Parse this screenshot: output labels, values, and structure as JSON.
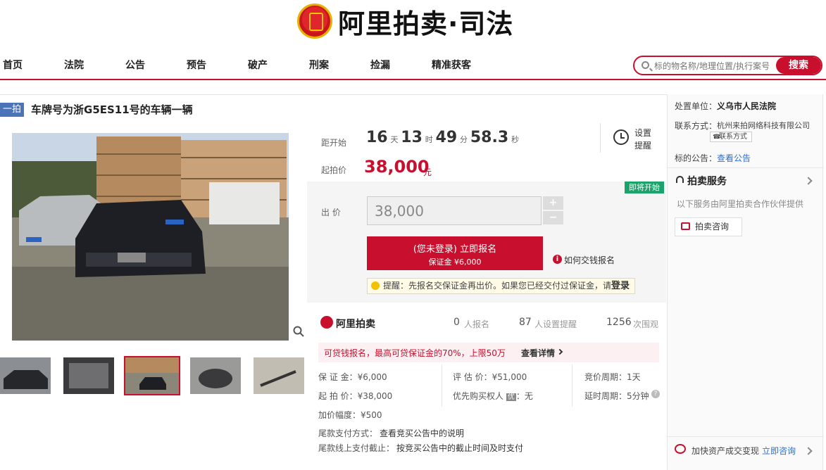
{
  "header": {
    "logo_text": "阿里拍卖·司法"
  },
  "nav": {
    "items": [
      "首页",
      "法院",
      "公告",
      "预告",
      "破产",
      "刑案",
      "捡漏",
      "精准获客"
    ]
  },
  "search": {
    "placeholder": "标的物名称/地理位置/执行案号",
    "button_label": "搜索"
  },
  "item": {
    "tag": "一拍",
    "title": "车牌号为浙G5ES11号的车辆一辆"
  },
  "timer": {
    "start_label": "距开始",
    "days": "16",
    "days_unit": "天",
    "hours": "13",
    "hours_unit": "时",
    "minutes": "49",
    "minutes_unit": "分",
    "seconds": "58.3",
    "seconds_unit": "秒",
    "reminder_label_1": "设置",
    "reminder_label_2": "提醒"
  },
  "start_price": {
    "label": "起拍价",
    "value": "38,000",
    "unit": "元"
  },
  "bid": {
    "soon_badge": "即将开始",
    "label": "出 价",
    "input_value": "38,000",
    "plus": "+",
    "minus": "−",
    "signup_line1": "(您未登录) 立即报名",
    "signup_line2": "保证金 ¥6,000",
    "how_pay": "如何交钱报名",
    "reminder_text": "提醒：先报名交保证金再出价。如果您已经交付过保证金，请",
    "reminder_login": "登录"
  },
  "stats": {
    "brand": "阿里拍卖",
    "signups": "0",
    "signups_label": "人报名",
    "reminders": "87",
    "reminders_label": "人设置提醒",
    "views": "1256",
    "views_label": "次围观"
  },
  "loan_notice": {
    "text": "可贷钱报名，最高可贷保证金的70%，上限50万",
    "link": "查看详情"
  },
  "details": {
    "deposit": "保 证 金：¥6,000",
    "appraisal": "评 估 价：¥51,000",
    "cycle": "竞价周期：1天",
    "start": "起 拍 价：¥38,000",
    "priority_label": "优先购买权人",
    "priority_badge": "优",
    "priority_value": "：无",
    "delay": "延时周期：5分钟",
    "increment": "加价幅度：¥500",
    "final_pay": "尾款支付方式：",
    "final_pay_value": "查看竞买公告中的说明",
    "final_deadline": "尾款线上支付截止：",
    "final_deadline_value": "按竞买公告中的截止时间及时支付"
  },
  "side": {
    "unit_label": "处置单位：",
    "unit_value": "义乌市人民法院",
    "contact_label": "联系方式：",
    "contact_value": "杭州来拍网络科技有限公司",
    "contact_tag": "联系方式",
    "notice_label": "标的公告：",
    "notice_link": "查看公告",
    "service_title": "拍卖服务",
    "service_desc": "以下服务由阿里拍卖合作伙伴提供",
    "consult_label": "拍卖咨询",
    "speedup": "加快资产成交变现",
    "speedup_link": "立即咨询"
  },
  "colors": {
    "accent": "#c8102e",
    "tag_blue": "#4a73b8",
    "green": "#1aa36a",
    "link": "#2c6fd1"
  }
}
